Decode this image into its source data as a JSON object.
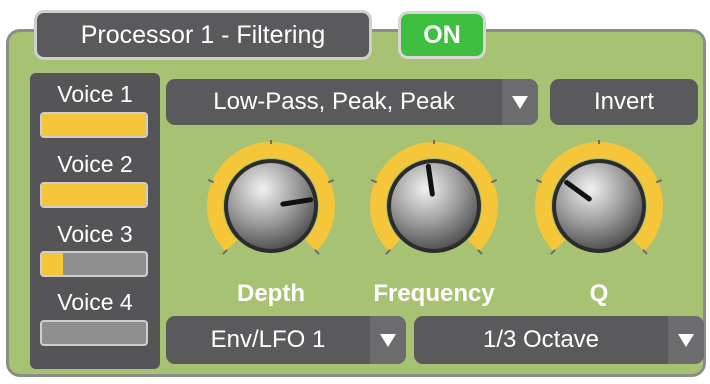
{
  "processor": {
    "title": "Processor 1 - Filtering",
    "on_label": "ON"
  },
  "voices": [
    {
      "label": "Voice 1",
      "level": 1.0
    },
    {
      "label": "Voice 2",
      "level": 1.0
    },
    {
      "label": "Voice 3",
      "level": 0.2
    },
    {
      "label": "Voice 4",
      "level": 0.0
    }
  ],
  "filter_type": {
    "selected": "Low-Pass, Peak, Peak"
  },
  "invert_label": "Invert",
  "knobs": [
    {
      "label": "Depth",
      "value": 0.8
    },
    {
      "label": "Frequency",
      "value": 0.47
    },
    {
      "label": "Q",
      "value": 0.3
    }
  ],
  "modulation_source": {
    "selected": "Env/LFO 1"
  },
  "bandwidth": {
    "selected": "1/3 Octave"
  },
  "colors": {
    "panel": "#a8c274",
    "on_green": "#3fbf3f",
    "accent_yellow": "#f5c53a",
    "dark_control": "#5a5a5c"
  }
}
